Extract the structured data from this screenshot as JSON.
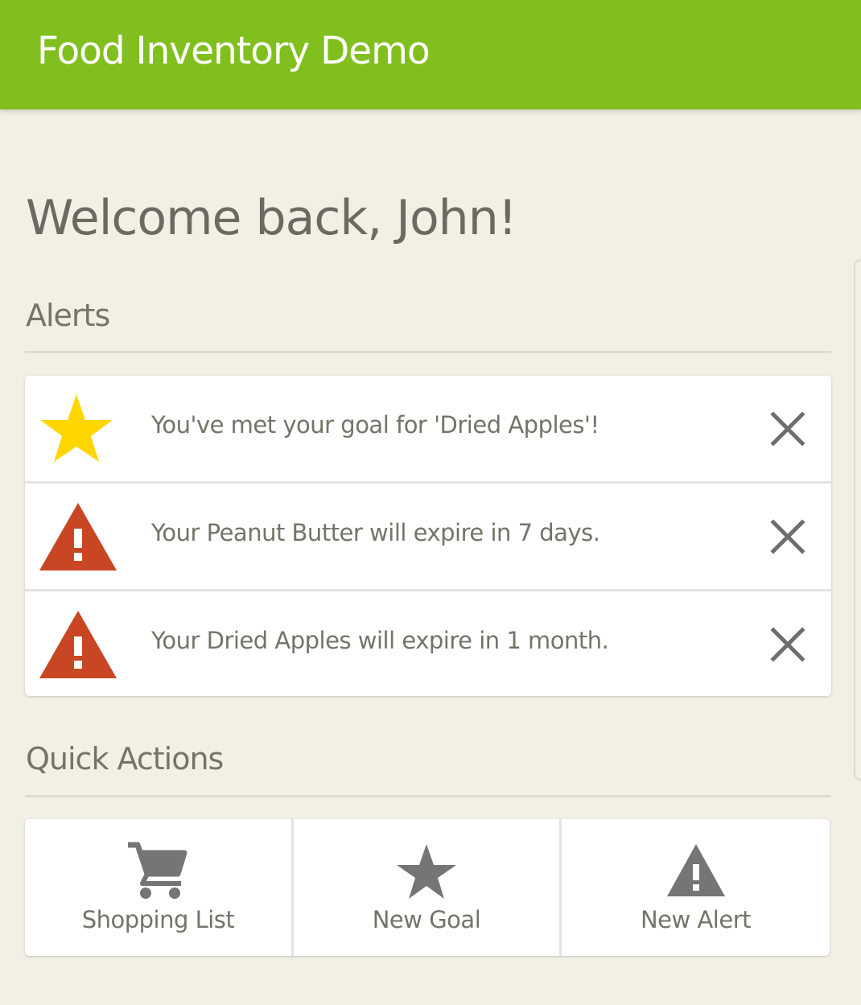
{
  "app": {
    "title": "Food Inventory Demo",
    "accent_color": "#80bf1e"
  },
  "welcome": {
    "text": "Welcome back, John!"
  },
  "alerts_section": {
    "title": "Alerts",
    "items": [
      {
        "icon": "star-icon",
        "icon_color": "#ffd600",
        "text": "You've met your goal for 'Dried Apples'!",
        "dismiss_icon": "close-icon"
      },
      {
        "icon": "warning-icon",
        "icon_color": "#c84624",
        "text": "Your Peanut Butter will expire in 7 days.",
        "dismiss_icon": "close-icon"
      },
      {
        "icon": "warning-icon",
        "icon_color": "#c84624",
        "text": "Your Dried Apples will expire in 1 month.",
        "dismiss_icon": "close-icon"
      }
    ]
  },
  "quick_actions_section": {
    "title": "Quick Actions",
    "items": [
      {
        "icon": "shopping-cart-icon",
        "label": "Shopping List"
      },
      {
        "icon": "star-icon",
        "label": "New Goal"
      },
      {
        "icon": "warning-icon",
        "label": "New Alert"
      }
    ],
    "icon_color": "#757575"
  }
}
